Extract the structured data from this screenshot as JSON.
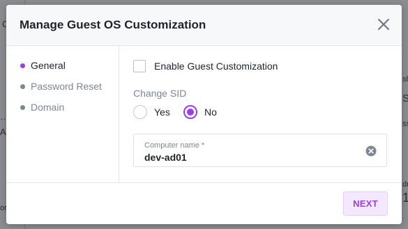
{
  "background": {
    "fragments": [
      "C",
      "…",
      "A.",
      "sh",
      "S",
      "ss",
      "dr",
      "1",
      "or"
    ]
  },
  "modal": {
    "title": "Manage Guest OS Customization",
    "close_icon": "close-icon"
  },
  "sidebar": {
    "items": [
      {
        "label": "General",
        "active": true
      },
      {
        "label": "Password Reset",
        "active": false
      },
      {
        "label": "Domain",
        "active": false
      }
    ]
  },
  "form": {
    "enable_label": "Enable Guest Customization",
    "enable_checked": false,
    "change_sid_label": "Change SID",
    "sid_options": [
      {
        "label": "Yes",
        "selected": false
      },
      {
        "label": "No",
        "selected": true
      }
    ],
    "computer_name": {
      "label": "Computer name *",
      "value": "dev-ad01",
      "clear_icon": "clear-circle-icon"
    }
  },
  "footer": {
    "next_label": "NEXT"
  },
  "colors": {
    "accent": "#9b3ee8",
    "overlay": "#8b8d90",
    "muted_text": "#7d8791"
  }
}
